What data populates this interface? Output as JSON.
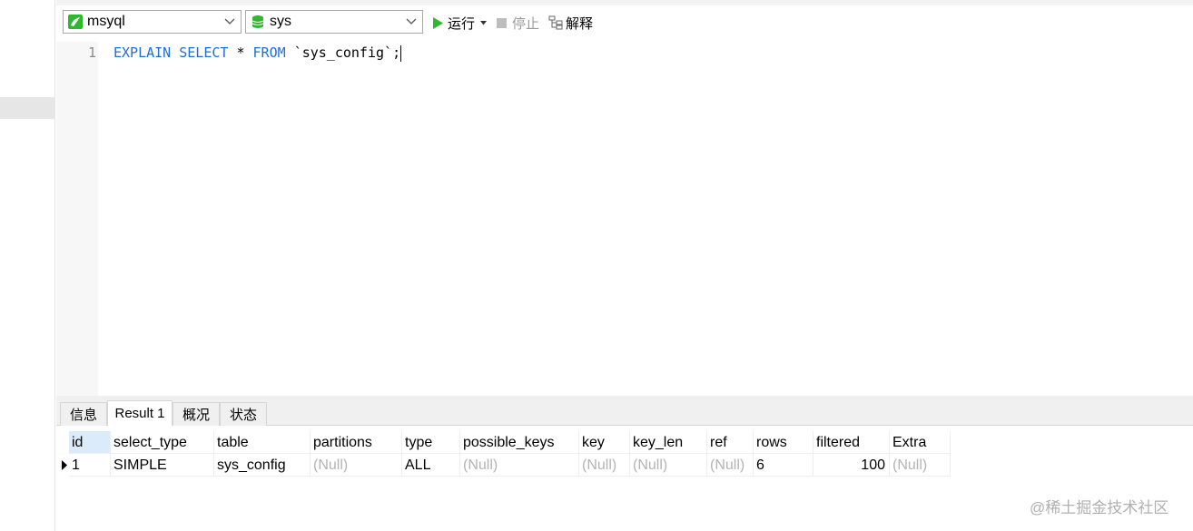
{
  "toolbar": {
    "connection": "msyql",
    "database": "sys",
    "run_label": "运行",
    "stop_label": "停止",
    "explain_label": "解释"
  },
  "editor": {
    "line_number": "1",
    "kw1": "EXPLAIN",
    "kw2": "SELECT",
    "star": "*",
    "kw3": "FROM",
    "table_ref": "`sys_config`",
    "semicolon": ";"
  },
  "tabs": [
    {
      "label": "信息"
    },
    {
      "label": "Result 1"
    },
    {
      "label": "概况"
    },
    {
      "label": "状态"
    }
  ],
  "result": {
    "columns": [
      "id",
      "select_type",
      "table",
      "partitions",
      "type",
      "possible_keys",
      "key",
      "key_len",
      "ref",
      "rows",
      "filtered",
      "Extra"
    ],
    "rows": [
      [
        "1",
        "SIMPLE",
        "sys_config",
        "(Null)",
        "ALL",
        "(Null)",
        "(Null)",
        "(Null)",
        "(Null)",
        "6",
        "100",
        "(Null)"
      ]
    ]
  },
  "watermark": "@稀土掘金技术社区",
  "colors": {
    "keyword": "#1c6fd6",
    "run_green": "#2eb82e",
    "null_text": "#b4b4b4"
  }
}
